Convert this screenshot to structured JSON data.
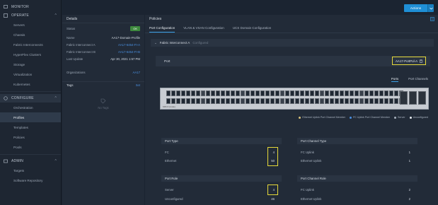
{
  "sidebar": {
    "monitor": "MONITOR",
    "operate": "OPERATE",
    "operate_items": [
      "Servers",
      "Chassis",
      "Fabric Interconnects",
      "HyperFlex Clusters",
      "Storage",
      "Virtualization",
      "Kubernetes"
    ],
    "configure": "CONFIGURE",
    "configure_items": [
      "Orchestration",
      "Profiles",
      "Templates",
      "Policies",
      "Pools"
    ],
    "selected": "Profiles",
    "admin": "ADMIN",
    "admin_items": [
      "Targets",
      "Software Repository"
    ]
  },
  "topbar": {
    "actions_label": "Actions",
    "caret": "|⌄"
  },
  "details": {
    "title": "Details",
    "status_label": "Status",
    "status_value": "OK",
    "name_label": "Name",
    "name_value": "AA17-Domain-Profile",
    "fia_label": "Fabric Interconnect A",
    "fia_value": "AA17-6454-FI-A",
    "fib_label": "Fabric Interconnect B",
    "fib_value": "AA17-6454-FI-B",
    "update_label": "Last Update",
    "update_value": "Apr 30, 2021 1:57 PM",
    "org_label": "Organizations",
    "org_value": "AA17",
    "tags_label": "Tags",
    "tags_edit": "Set",
    "no_tags": "No Tags"
  },
  "policies": {
    "title": "Policies",
    "tabs": [
      "Port Configuration",
      "VLAN & VSAN Configuration",
      "UCS Domain Configuration"
    ],
    "fi_label": "Fabric Interconnect A",
    "fi_status": "Configured",
    "port_label": "Port",
    "port_policy": "AA17-PortPol-A",
    "subtabs": [
      "Ports",
      "Port Channels"
    ],
    "switch_label": "6454 FI (A side)",
    "legend": [
      {
        "label": "Ethernet Uplink Port Channel Member",
        "color": "#d9c27a"
      },
      {
        "label": "FC Uplink Port Channel Member",
        "color": "#4a90e2"
      },
      {
        "label": "Server",
        "color": "#a8b2be"
      },
      {
        "label": "Unconfigured",
        "color": "#e6ebf0"
      }
    ],
    "port_type": {
      "title": "Port Type",
      "rows": [
        [
          "FC",
          "4"
        ],
        [
          "Ethernet",
          "50"
        ]
      ]
    },
    "port_role": {
      "title": "Port Role",
      "rows": [
        [
          "Server",
          "4"
        ],
        [
          "Unconfigured",
          "46"
        ]
      ]
    },
    "pc_type": {
      "title": "Port Channel Type",
      "rows": [
        [
          "FC Uplink",
          "1"
        ],
        [
          "Ethernet Uplink",
          "1"
        ]
      ]
    },
    "pc_role": {
      "title": "Port Channel Role",
      "rows": [
        [
          "FC Uplink",
          "2"
        ],
        [
          "Ethernet Uplink",
          "2"
        ]
      ]
    }
  },
  "colors": {
    "accent": "#1f8fd6",
    "highlight": "#e6d93a",
    "ok": "#3e8a3e"
  }
}
